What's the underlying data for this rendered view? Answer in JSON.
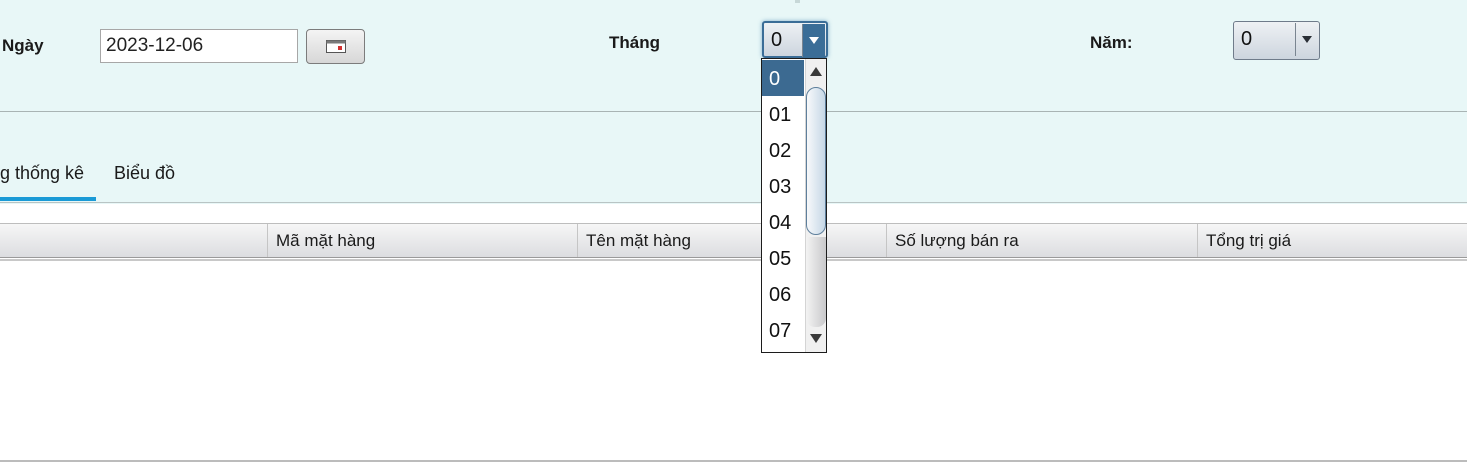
{
  "filters": {
    "day_label": "Ngày",
    "day_value": "2023-12-06",
    "month_label": "Tháng",
    "month_value": "0",
    "year_label": "Năm:",
    "year_value": "0"
  },
  "tabs": [
    {
      "label": "g thống kê",
      "active": true
    },
    {
      "label": "Biểu đồ",
      "active": false
    }
  ],
  "grid": {
    "columns": [
      "Mã mặt hàng",
      "Tên mặt hàng",
      "Số lượng bán ra",
      "Tổng trị giá"
    ]
  },
  "month_dropdown": {
    "options": [
      "0",
      "01",
      "02",
      "03",
      "04",
      "05",
      "06",
      "07"
    ],
    "selected": "0"
  },
  "colors": {
    "panel_bg": "#e8f7f7",
    "accent": "#1a9ad6",
    "selection": "#3c6a91"
  },
  "icons": {
    "calendar": "calendar-icon",
    "dropdown": "chevron-down-icon"
  }
}
